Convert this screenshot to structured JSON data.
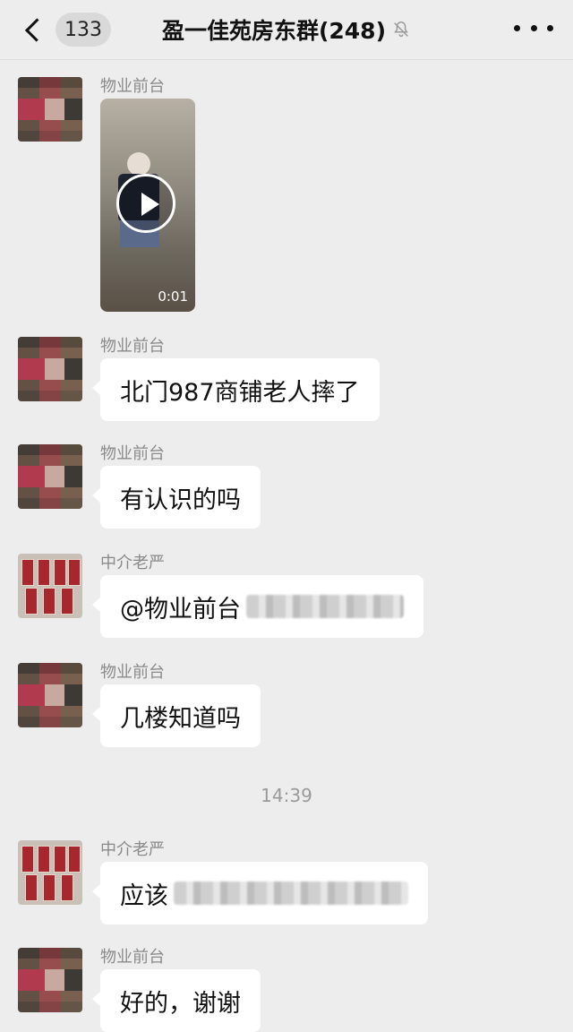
{
  "header": {
    "unread_count": "133",
    "title": "盈一佳苑房东群(248)",
    "back_icon": "chevron-left-icon",
    "mute_icon": "bell-muted-icon",
    "more_icon": "more-dots-icon"
  },
  "messages": [
    {
      "sender": "物业前台",
      "type": "video",
      "duration": "0:01"
    },
    {
      "sender": "物业前台",
      "type": "text",
      "text": "北门987商铺老人摔了"
    },
    {
      "sender": "物业前台",
      "type": "text",
      "text": "有认识的吗"
    },
    {
      "sender": "中介老严",
      "type": "text",
      "text": "@物业前台"
    },
    {
      "sender": "物业前台",
      "type": "text",
      "text": "几楼知道吗"
    },
    {
      "sender": "中介老严",
      "type": "text",
      "text": "应该"
    },
    {
      "sender": "物业前台",
      "type": "text",
      "text": "好的，谢谢"
    }
  ],
  "time_separator": "14:39",
  "colors": {
    "background": "#ededed",
    "bubble": "#ffffff",
    "sender": "#8a8a8a"
  }
}
